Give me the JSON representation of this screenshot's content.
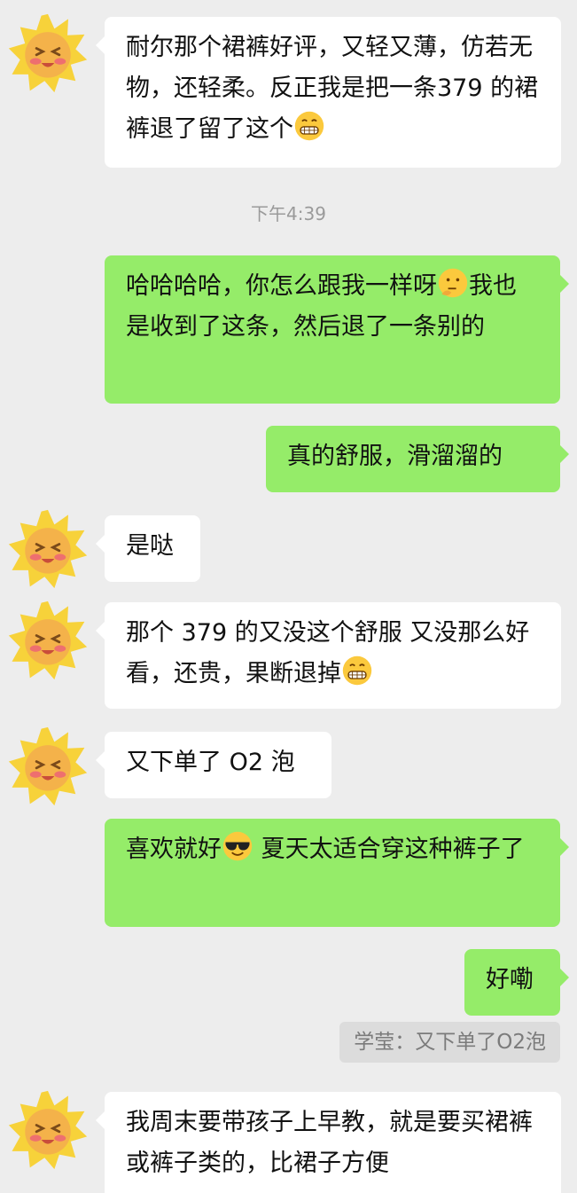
{
  "timestamp": "下午4:39",
  "messages": [
    {
      "text_pre": "耐尔那个裙裤好评，又轻又薄，仿若无物，还轻柔。反正我是把一条379 的裙裤退了留了这个",
      "emoji": "grin-emoji"
    },
    {
      "text_pre": "哈哈哈哈，你怎么跟我一样呀",
      "emoji": "thinking-emoji",
      "text_post": "我也是收到了这条，然后退了一条别的"
    },
    {
      "text": "真的舒服，滑溜溜的"
    },
    {
      "text": "是哒"
    },
    {
      "text_pre": "那个 379 的又没这个舒服 又没那么好看，还贵，果断退掉",
      "emoji": "grin-emoji"
    },
    {
      "text": "又下单了 O2 泡"
    },
    {
      "text_pre": "喜欢就好",
      "emoji": "sunglasses-emoji",
      "text_post": " 夏天太适合穿这种裤子了"
    },
    {
      "text": "好嘞"
    },
    {
      "text": "我周末要带孩子上早教，就是要买裙裤或裤子类的，比裙子方便"
    }
  ],
  "quote": "学莹：又下单了O2泡",
  "colors": {
    "background": "#ededed",
    "incoming": "#ffffff",
    "outgoing": "#95ec69"
  },
  "avatar_icon": "sun-avatar-icon"
}
